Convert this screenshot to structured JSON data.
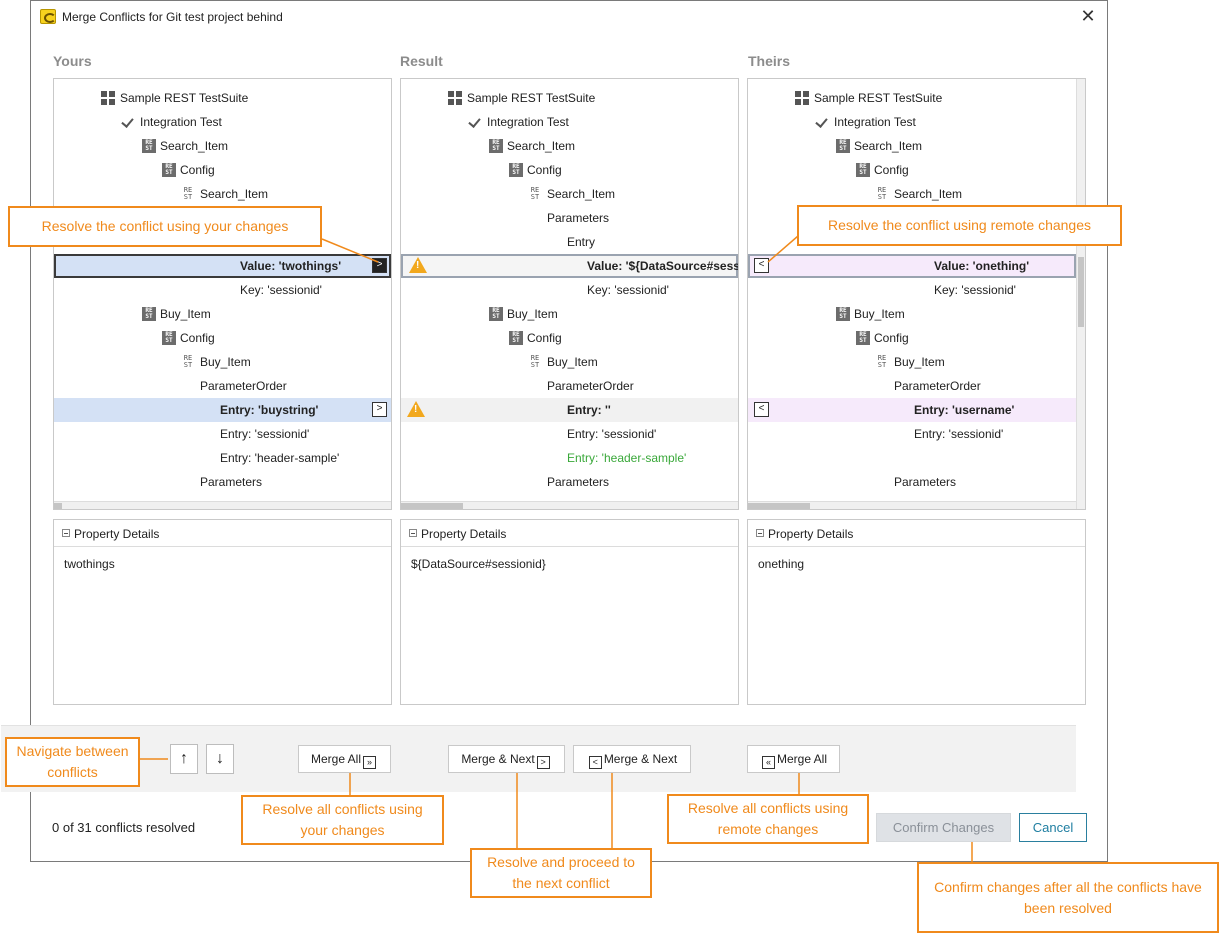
{
  "window": {
    "title": "Merge Conflicts for Git test project behind",
    "close_glyph": "✕"
  },
  "columns": {
    "yours": "Yours",
    "result": "Result",
    "theirs": "Theirs"
  },
  "yours_tree": [
    {
      "label": "Sample REST TestSuite"
    },
    {
      "label": "Integration Test"
    },
    {
      "label": "Search_Item"
    },
    {
      "label": "Config"
    },
    {
      "label": "Search_Item"
    },
    {
      "label": "Value: 'twothings'"
    },
    {
      "label": "Key: 'sessionid'"
    },
    {
      "label": "Buy_Item"
    },
    {
      "label": "Config"
    },
    {
      "label": "Buy_Item"
    },
    {
      "label": "ParameterOrder"
    },
    {
      "label": "Entry: 'buystring'"
    },
    {
      "label": "Entry: 'sessionid'"
    },
    {
      "label": "Entry: 'header-sample'"
    },
    {
      "label": "Parameters"
    }
  ],
  "result_tree": [
    {
      "label": "Sample REST TestSuite"
    },
    {
      "label": "Integration Test"
    },
    {
      "label": "Search_Item"
    },
    {
      "label": "Config"
    },
    {
      "label": "Search_Item"
    },
    {
      "label": "Parameters"
    },
    {
      "label": "Entry"
    },
    {
      "label": "Value: '${DataSource#sessi"
    },
    {
      "label": "Key: 'sessionid'"
    },
    {
      "label": "Buy_Item"
    },
    {
      "label": "Config"
    },
    {
      "label": "Buy_Item"
    },
    {
      "label": "ParameterOrder"
    },
    {
      "label": "Entry: ''"
    },
    {
      "label": "Entry: 'sessionid'"
    },
    {
      "label": "Entry: 'header-sample'"
    },
    {
      "label": "Parameters"
    }
  ],
  "theirs_tree": [
    {
      "label": "Sample REST TestSuite"
    },
    {
      "label": "Integration Test"
    },
    {
      "label": "Search_Item"
    },
    {
      "label": "Config"
    },
    {
      "label": "Search_Item"
    },
    {
      "label": "Value: 'onething'"
    },
    {
      "label": "Key: 'sessionid'"
    },
    {
      "label": "Buy_Item"
    },
    {
      "label": "Config"
    },
    {
      "label": "Buy_Item"
    },
    {
      "label": "ParameterOrder"
    },
    {
      "label": "Entry: 'username'"
    },
    {
      "label": "Entry: 'sessionid'"
    },
    {
      "label": "Parameters"
    }
  ],
  "icons": {
    "rest_top": "RE",
    "rest_bottom": "ST",
    "accept_right": ">",
    "accept_left": "<"
  },
  "property_details": {
    "header": "Property Details",
    "yours_value": "twothings",
    "result_value": "${DataSource#sessionid}",
    "theirs_value": "onething"
  },
  "toolbar": {
    "prev_glyph": "↑",
    "next_glyph": "↓",
    "merge_all_yours": "Merge All",
    "merge_next_yours": "Merge & Next",
    "merge_next_theirs": "Merge & Next",
    "merge_all_theirs": "Merge All",
    "double_right": "»",
    "single_right": ">",
    "single_left": "<",
    "double_left": "«"
  },
  "footer": {
    "status": "0 of 31 conflicts resolved",
    "confirm": "Confirm Changes",
    "cancel": "Cancel"
  },
  "callouts": {
    "yours": "Resolve the conflict using your changes",
    "remote": "Resolve the conflict using remote changes",
    "navigate": "Navigate between conflicts",
    "all_yours": "Resolve all conflicts using your changes",
    "merge_next": "Resolve and proceed to the next conflict",
    "all_remote": "Resolve all conflicts using remote changes",
    "confirm": "Confirm changes after all the conflicts have been resolved"
  },
  "colors": {
    "callout": "#f08a1c",
    "yours_highlight": "#d4e1f5",
    "theirs_highlight": "#f6eafb",
    "warning": "#f2a81d",
    "added_text": "#3aa83a"
  }
}
